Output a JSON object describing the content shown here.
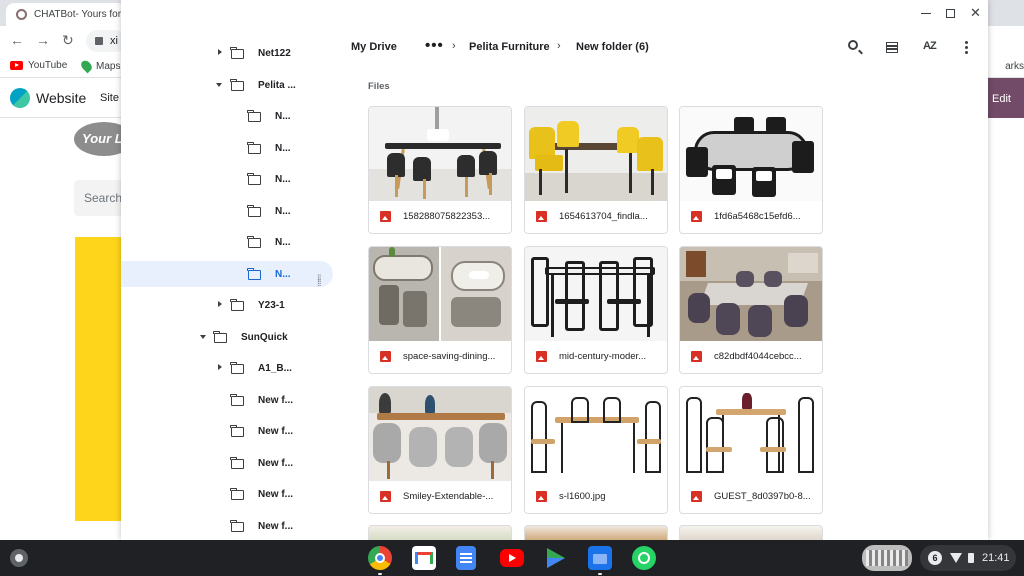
{
  "background": {
    "tab_title": "CHATBot- Yours for t",
    "omnibox_text": "xi",
    "bookmarks": [
      {
        "label": "YouTube"
      },
      {
        "label": "Maps"
      }
    ],
    "bookmarks_right": "arks",
    "site_name": "Website",
    "site_nav": "Site",
    "edit_label": "Edit",
    "logo_text": "Your Lo",
    "search_placeholder": "Search",
    "colors": {
      "accent_purple": "#714b67",
      "yellow": "#fed51a"
    }
  },
  "window_controls": {
    "minimize": "–",
    "maximize": "□",
    "close": "✕"
  },
  "sidebar": {
    "items": [
      {
        "label": "Net122"
      },
      {
        "label": "Pelita ..."
      },
      {
        "label": "N..."
      },
      {
        "label": "N..."
      },
      {
        "label": "N..."
      },
      {
        "label": "N..."
      },
      {
        "label": "N..."
      },
      {
        "label": "N..."
      },
      {
        "label": "Y23-1"
      },
      {
        "label": "SunQuick"
      },
      {
        "label": "A1_B..."
      },
      {
        "label": "New f..."
      },
      {
        "label": "New f..."
      },
      {
        "label": "New f..."
      },
      {
        "label": "New f..."
      },
      {
        "label": "New f..."
      }
    ]
  },
  "breadcrumb": {
    "root": "My Drive",
    "ellipsis": "•••",
    "parent": "Pelita Furniture",
    "current": "New folder (6)",
    "separator": "›"
  },
  "toolbar": {
    "search_icon": "search-icon",
    "view_icon": "list-view-icon",
    "sort_label": "AZ",
    "more_icon": "more-vert-icon"
  },
  "files": {
    "section_label": "Files",
    "items": [
      {
        "name": "158288075822353..."
      },
      {
        "name": "1654613704_findla..."
      },
      {
        "name": "1fd6a5468c15efd6..."
      },
      {
        "name": "space-saving-dining..."
      },
      {
        "name": "mid-century-moder..."
      },
      {
        "name": "c82dbdf4044cebcc..."
      },
      {
        "name": "Smiley-Extendable-..."
      },
      {
        "name": "s-l1600.jpg"
      },
      {
        "name": "GUEST_8d0397b0-8..."
      }
    ]
  },
  "shelf": {
    "apps": [
      "chrome-icon",
      "gmail-icon",
      "docs-icon",
      "youtube-icon",
      "play-store-icon",
      "files-icon",
      "whatsapp-icon"
    ],
    "notification_count": "6",
    "time": "21:41"
  }
}
